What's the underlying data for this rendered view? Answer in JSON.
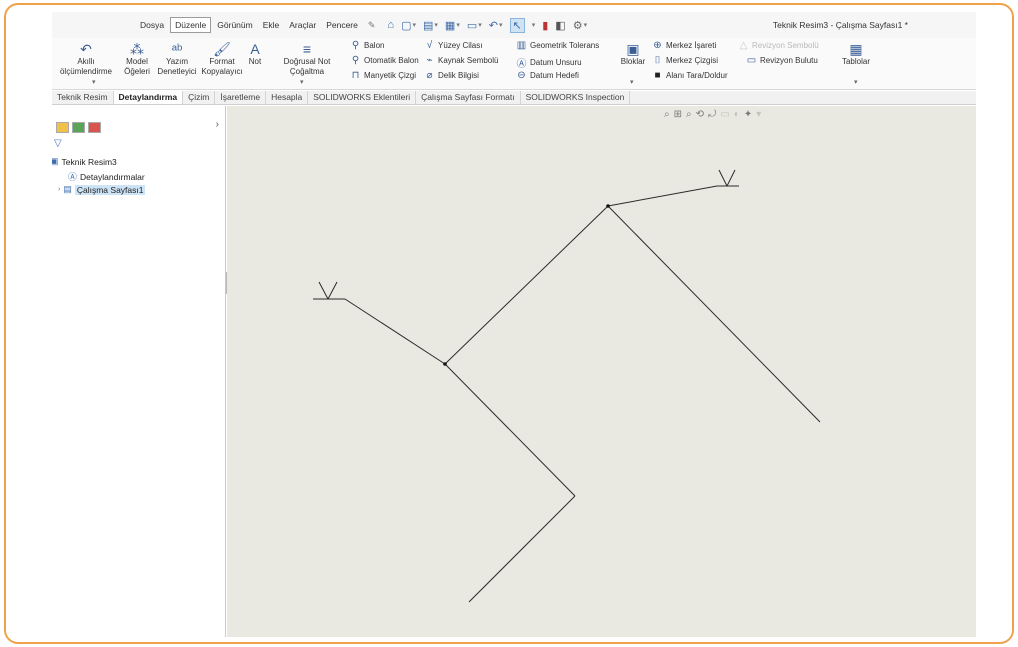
{
  "menu": {
    "items": [
      "Dosya",
      "Düzenle",
      "Görünüm",
      "Ekle",
      "Araçlar",
      "Pencere"
    ],
    "active_index": 1,
    "pin_icon": "pin-icon",
    "document_title": "Teknik Resim3 - Çalışma Sayfası1 *"
  },
  "quick_access": [
    "home-icon",
    "new-document-icon",
    "open-icon",
    "save-icon",
    "print-icon",
    "undo-icon",
    "select-icon",
    "traffic-light-icon",
    "options-icon",
    "settings-icon"
  ],
  "ribbon": {
    "btn_autodim": "Akıllı ölçümlendirme",
    "btn_model_items": "Model Öğeleri",
    "btn_spell": "Yazım Denetleyici",
    "btn_format_painter": "Format Kopyalayıcı",
    "btn_note": "Not",
    "btn_linear_pattern": "Doğrusal Not Çoğaltma",
    "balloon": "Balon",
    "auto_balloon": "Otomatik Balon",
    "magnetic_line": "Manyetik Çizgi",
    "surface_finish": "Yüzey Cilası",
    "weld_symbol": "Kaynak Sembolü",
    "hole_callout": "Delik Bilgisi",
    "geometric_tolerance": "Geometrik Tolerans",
    "datum_feature": "Datum Unsuru",
    "datum_target": "Datum Hedefi",
    "blocks": "Bloklar",
    "center_mark": "Merkez İşareti",
    "centerline": "Merkez Çizgisi",
    "area_hatch": "Alanı Tara/Doldur",
    "revision_symbol": "Revizyon Sembolü",
    "revision_cloud": "Revizyon Bulutu",
    "tables": "Tablolar"
  },
  "tabs": [
    "Teknik Resim",
    "Detaylandırma",
    "Çizim",
    "İşaretleme",
    "Hesapla",
    "SOLIDWORKS Eklentileri",
    "Çalışma Sayfası Formatı",
    "SOLIDWORKS Inspection"
  ],
  "active_tab_index": 1,
  "feature_tree": {
    "root": "Teknik Resim3",
    "annotations": "Detaylandırmalar",
    "sheet": "Çalışma Sayfası1"
  },
  "colors": {
    "canvas": "#e9e9e1",
    "frame_accent": "#f0a24a",
    "selection": "#cde4f7"
  }
}
